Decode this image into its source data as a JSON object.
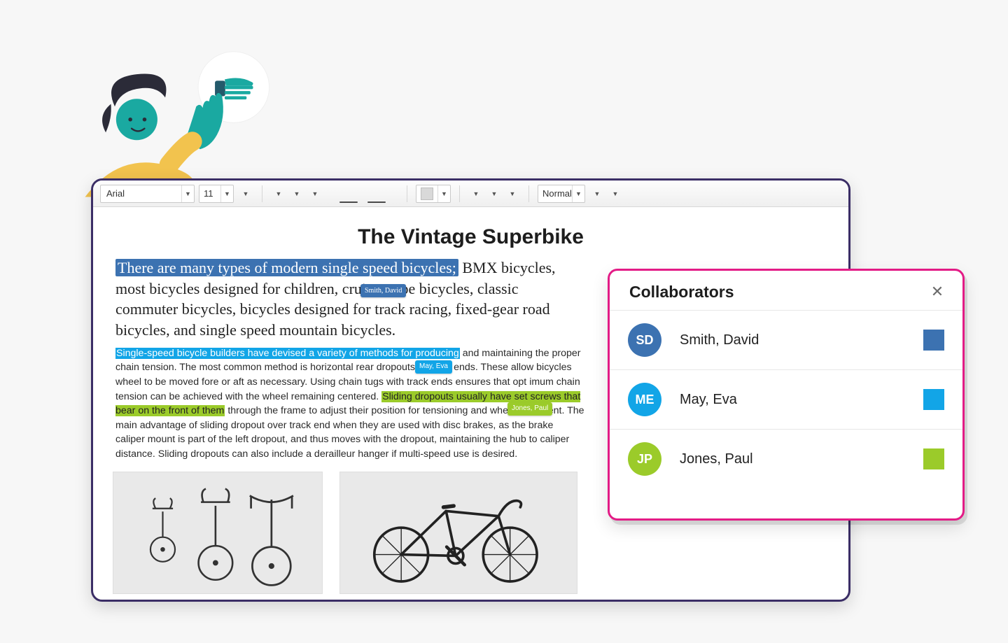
{
  "toolbar": {
    "font": "Arial",
    "size": "11",
    "style_label": "Normal"
  },
  "document": {
    "title": "The Vintage Superbike",
    "lead_highlighted": "There are many types of modern single speed bicycles;",
    "lead_rest": " BMX bicycles, most bicycles designed for children, cruises type bicycles, classic commuter bicycles, bicycles designed for track racing, fixed-gear road bicycles, and single speed mountain bicycles.",
    "body_sel_blue": "Single-speed bicycle builders have devised a variety of methods for producing",
    "body_mid1": " and maintaining the proper chain ten­sion. The most common method is horizontal rear dropouts or track ends. These allow bicycles wheel to be moved fore or aft as necessary. Using chain tugs with track ends ensures that opt imum chain tension can be achieved with the wheel remaining centered. ",
    "body_sel_green": "Sliding dropouts usually have set screws that bear on the front of them",
    "body_mid2": " through the frame to adjust their position for tensioning and wheel alignment. The main advantage of sliding dropout over track end when they are used with disc brakes, as the brake caliper mount is part of the left dropout, and thus moves with the dropout, maintaining the hub to caliper distance. Sliding dropouts can also include a derailleur hanger if multi-speed use is desired.",
    "tags": {
      "smith": "Smith, David",
      "may": "May, Eva",
      "jones": "Jones, Paul"
    }
  },
  "collaborators": {
    "title": "Collaborators",
    "items": [
      {
        "initials": "SD",
        "name": "Smith, David",
        "color": "#3c72b1"
      },
      {
        "initials": "ME",
        "name": "May, Eva",
        "color": "#12a5e7"
      },
      {
        "initials": "JP",
        "name": "Jones, Paul",
        "color": "#9bcb2a"
      }
    ]
  }
}
